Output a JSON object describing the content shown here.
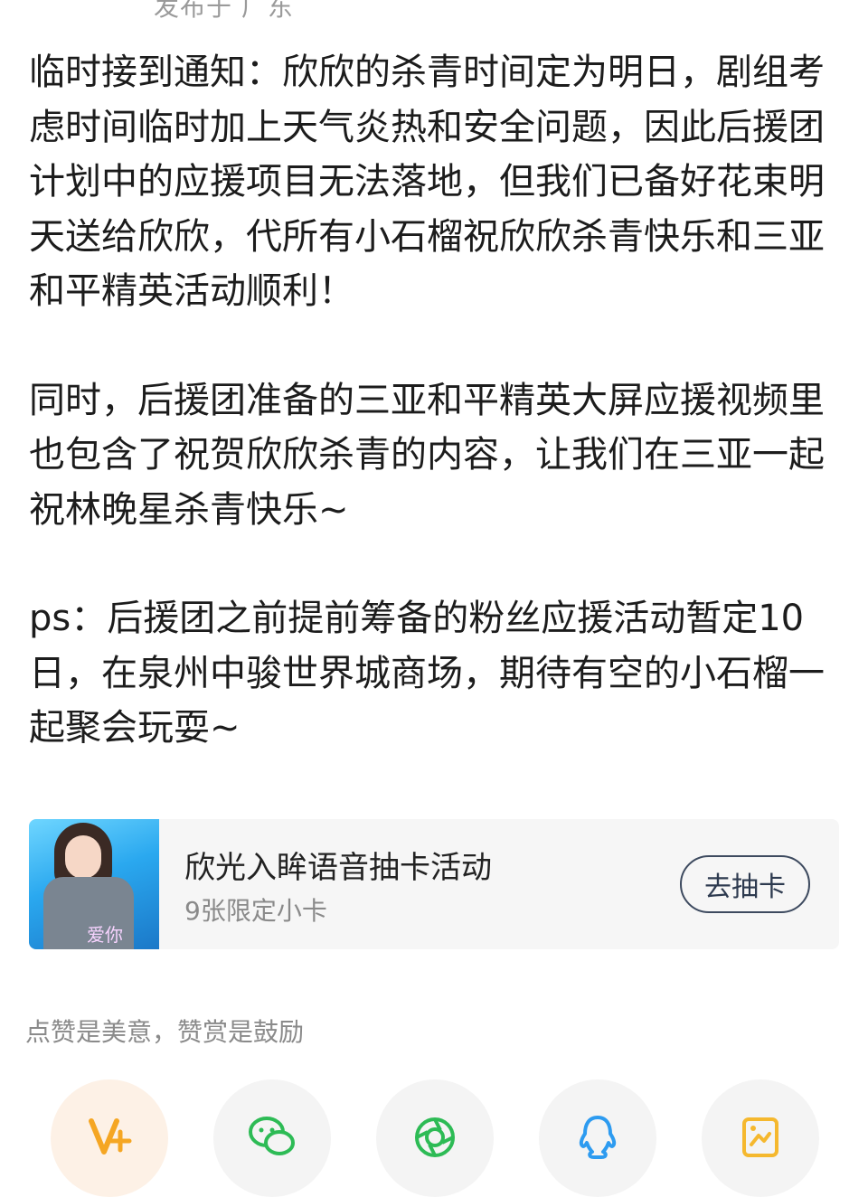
{
  "post": {
    "location_meta": "发布于 广东",
    "paragraphs": [
      "临时接到通知：欣欣的杀青时间定为明日，剧组考虑时间临时加上天气炎热和安全问题，因此后援团计划中的应援项目无法落地，但我们已备好花束明天送给欣欣，代所有小石榴祝欣欣杀青快乐和三亚和平精英活动顺利！",
      "同时，后援团准备的三亚和平精英大屏应援视频里也包含了祝贺欣欣杀青的内容，让我们在三亚一起祝林晚星杀青快乐~",
      "ps：后援团之前提前筹备的粉丝应援活动暂定10日，在泉州中骏世界城商场，期待有空的小石榴一起聚会玩耍~"
    ]
  },
  "promo": {
    "title": "欣光入眸语音抽卡活动",
    "subtitle": "9张限定小卡",
    "button_label": "去抽卡",
    "thumb_caption": "爱你"
  },
  "reward": {
    "hint": "点赞是美意，赞赏是鼓励"
  },
  "share": {
    "buttons": [
      {
        "icon": "v-plus-icon",
        "color": "#f5a623"
      },
      {
        "icon": "wechat-icon",
        "color": "#2dbb55"
      },
      {
        "icon": "moments-icon",
        "color": "#2dbb55"
      },
      {
        "icon": "qq-icon",
        "color": "#2d9bf0"
      },
      {
        "icon": "qzone-icon",
        "color": "#f5b82e"
      }
    ]
  }
}
